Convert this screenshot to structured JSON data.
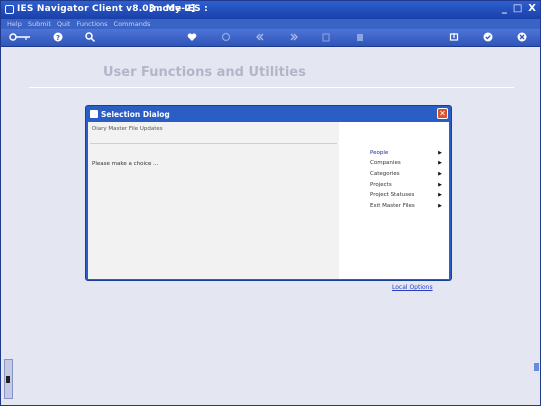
{
  "window": {
    "title": "IES Navigator Client v8.03 : My IES :",
    "mode": "[mode-2]",
    "controls": {
      "minimize": "_",
      "maximize": "□",
      "close": "X"
    }
  },
  "menubar": [
    "Help",
    "Submit",
    "Quit",
    "Functions",
    "Commands"
  ],
  "toolbar": {
    "icons": [
      "key-icon",
      "help-icon",
      "search-icon",
      "heart-icon",
      "refresh-icon",
      "rewind-icon",
      "fast-forward-icon",
      "copy-icon",
      "clipboard-icon",
      "export-icon",
      "check-icon",
      "close-icon"
    ]
  },
  "page": {
    "heading": "User Functions and Utilities",
    "local_options": "Local Options"
  },
  "dialog": {
    "title": "Selection Dialog",
    "close": "✕",
    "subtitle": "Diary Master File Updates",
    "prompt": "Please make a choice ...",
    "options": [
      {
        "label": "People",
        "active": true
      },
      {
        "label": "Companies",
        "active": false
      },
      {
        "label": "Categories",
        "active": false
      },
      {
        "label": "Projects",
        "active": false
      },
      {
        "label": "Project Statuses",
        "active": false
      },
      {
        "label": "Exit Master Files",
        "active": false
      }
    ],
    "arrow": "▶"
  },
  "colors": {
    "titlebar": "#1a3fa8",
    "background": "#e4e6f2",
    "active_option": "#1a2f9c",
    "link": "#2a3fc8"
  }
}
